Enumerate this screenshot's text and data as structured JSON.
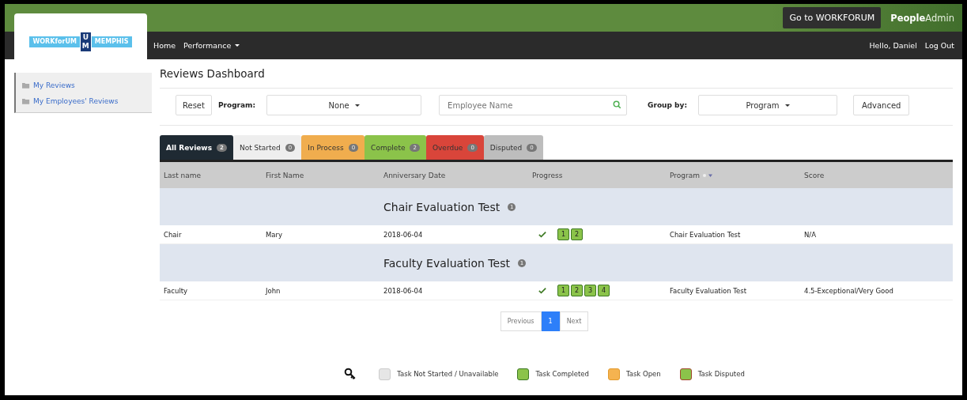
{
  "header": {
    "workforum_button": "Go to WORKFORUM",
    "brand_bold": "People",
    "brand_light": "Admin",
    "nav": [
      {
        "label": "Home",
        "dropdown": false
      },
      {
        "label": "Performance",
        "dropdown": true
      }
    ],
    "greeting": "Hello, Daniel",
    "logout": "Log Out"
  },
  "logo": {
    "left": "WORKforUM",
    "mark_top": "U",
    "mark_bottom": "M",
    "right": "MEMPHIS"
  },
  "sidebar": {
    "items": [
      {
        "label": "My Reviews"
      },
      {
        "label": "My Employees' Reviews"
      }
    ]
  },
  "page_title": "Reviews Dashboard",
  "filters": {
    "reset": "Reset",
    "program_label": "Program:",
    "program_value": "None",
    "search": {
      "placeholder": "Employee Name"
    },
    "group_label": "Group by:",
    "group_value": "Program",
    "advanced": "Advanced"
  },
  "tabs": [
    {
      "label": "All Reviews",
      "count": "2",
      "color": "#1f2a33",
      "selected": true
    },
    {
      "label": "Not Started",
      "count": "0",
      "color": "#eeeeee",
      "selected": false
    },
    {
      "label": "In Process",
      "count": "0",
      "color": "#f0ad4e",
      "selected": false
    },
    {
      "label": "Complete",
      "count": "2",
      "color": "#8bc34a",
      "selected": false
    },
    {
      "label": "Overdue",
      "count": "0",
      "color": "#d9453a",
      "selected": false
    },
    {
      "label": "Disputed",
      "count": "0",
      "color": "#bdbdbd",
      "selected": false
    }
  ],
  "table": {
    "columns": [
      "Last name",
      "First Name",
      "Anniversary Date",
      "Progress",
      "Program",
      "Score"
    ],
    "groups": [
      {
        "title": "Chair Evaluation Test",
        "count": "1",
        "rows": [
          {
            "last": "Chair",
            "first": "Mary",
            "date": "2018-06-04",
            "done": true,
            "tasks": [
              {
                "label": "1",
                "kind": "completed"
              },
              {
                "label": "2",
                "kind": "completed"
              }
            ],
            "program": "Chair Evaluation Test",
            "score": "N/A"
          }
        ]
      },
      {
        "title": "Faculty Evaluation Test",
        "count": "1",
        "rows": [
          {
            "last": "Faculty",
            "first": "John",
            "date": "2018-06-04",
            "done": true,
            "tasks": [
              {
                "label": "1",
                "kind": "completed"
              },
              {
                "label": "2",
                "kind": "completed"
              },
              {
                "label": "3",
                "kind": "completed"
              },
              {
                "label": "4",
                "kind": "completed"
              }
            ],
            "program": "Faculty Evaluation Test",
            "score": "4.5-Exceptional/Very Good"
          }
        ]
      }
    ]
  },
  "pagination": {
    "previous": "Previous",
    "pages": [
      {
        "label": "1",
        "selected": true
      }
    ],
    "next": "Next"
  },
  "legend": [
    {
      "label": "Task Not Started / Unavailable",
      "kind": "not_started"
    },
    {
      "label": "Task Completed",
      "kind": "completed"
    },
    {
      "label": "Task Open",
      "kind": "open"
    },
    {
      "label": "Task Disputed",
      "kind": "disputed"
    }
  ]
}
